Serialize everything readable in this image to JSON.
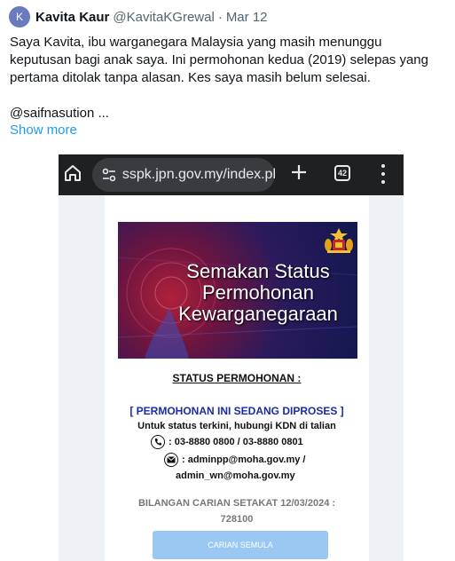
{
  "tweet": {
    "avatar_letter": "K",
    "display_name": "Kavita Kaur",
    "handle": "@KavitaKGrewal",
    "separator": "·",
    "date": "Mar 12",
    "text_lines": [
      "Saya Kavita,  ibu warganegara Malaysia yang masih menunggu",
      "keputusan bagi anak saya. Ini  permohonan  kedua (2019)  selepas yang",
      "pertama ditolak tanpa alasan. Kes saya masih belum selesai."
    ],
    "mention_line": "@saifnasution ...",
    "show_more": "Show more"
  },
  "browser": {
    "url": "sspk.jpn.gov.my/index.pl",
    "tab_count": "42",
    "icons": [
      "home-icon",
      "site-settings-icon",
      "plus-icon",
      "tabs-icon",
      "kebab-menu-icon"
    ]
  },
  "page": {
    "banner_lines": [
      "Semakan Status",
      "Permohonan",
      "Kewarganegaraan"
    ],
    "status_heading": "STATUS PERMOHONAN :",
    "status_value": "[ PERMOHONAN INI SEDANG DIPROSES ]",
    "info_line": "Untuk status terkini, hubungi KDN di talian",
    "phone_numbers": ": 03-8880 0800 / 03-8880 0801",
    "email_line1": ": adminpp@moha.gov.my /",
    "email_line2": "admin_wn@moha.gov.my",
    "counter_label": "BILANGAN CARIAN SETAKAT 12/03/2024 :",
    "counter_value": "728100",
    "search_again_button": "CARIAN SEMULA"
  },
  "colors": {
    "link": "#1d9bf0",
    "status_value": "#1a2aa8",
    "button": "#9bc8f2",
    "browser_bar": "#1f2022"
  }
}
